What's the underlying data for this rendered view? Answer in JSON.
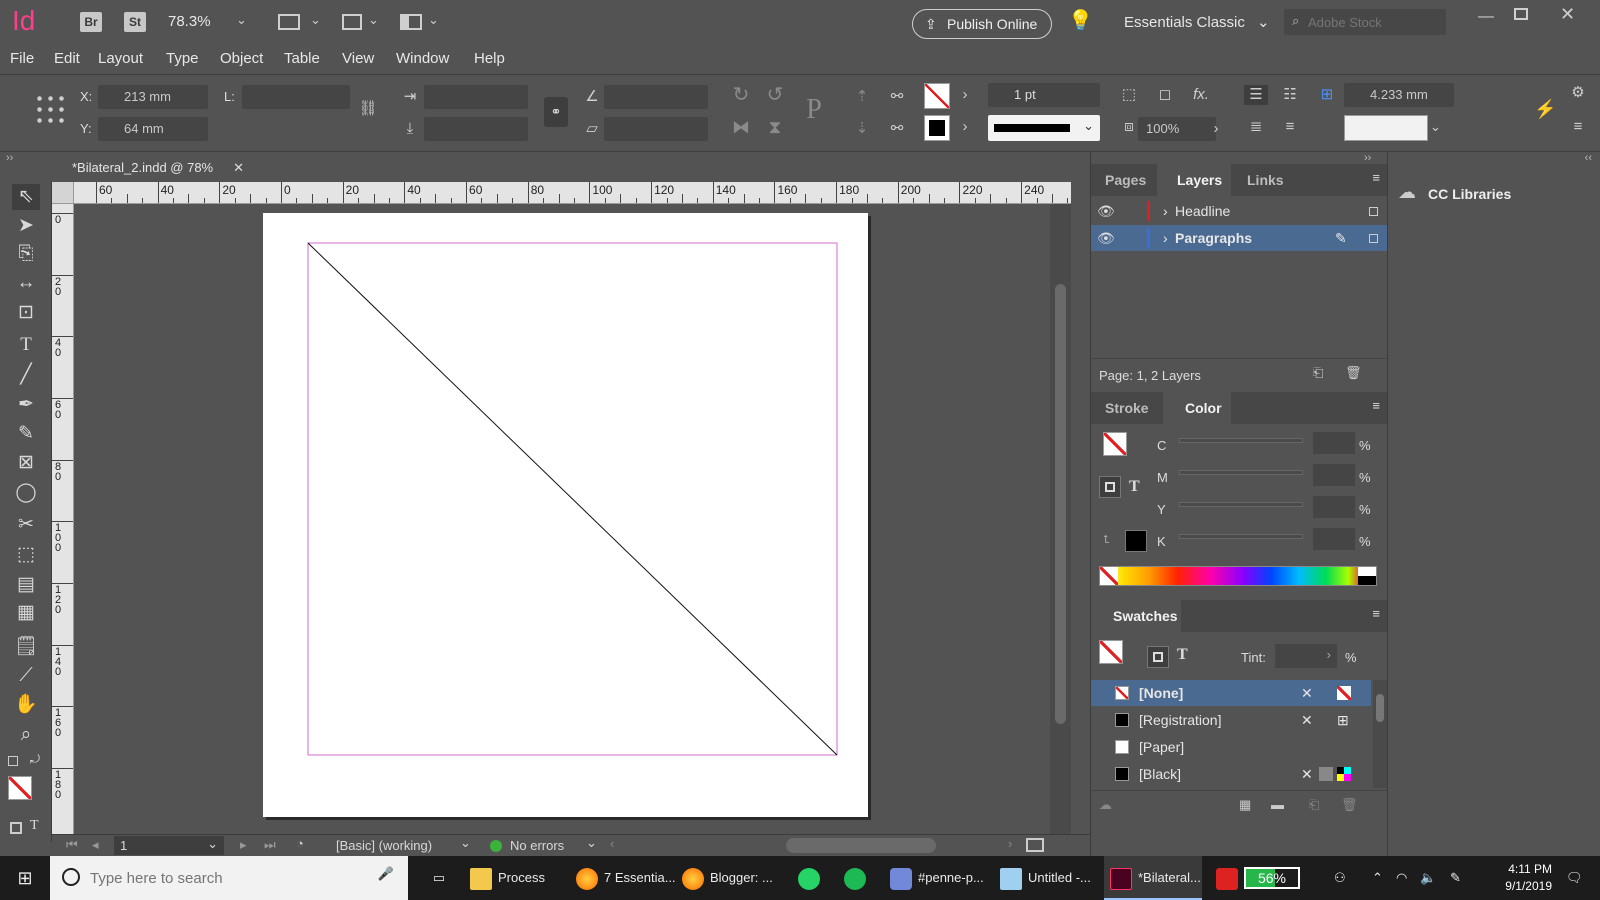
{
  "titlebar": {
    "app_logo": "Id",
    "bridge": "Br",
    "stock": "St",
    "zoom": "78.3%",
    "publish_online": "Publish Online",
    "workspace": "Essentials Classic",
    "search_placeholder": "Adobe Stock"
  },
  "menu": [
    "File",
    "Edit",
    "Layout",
    "Type",
    "Object",
    "Table",
    "View",
    "Window",
    "Help"
  ],
  "control": {
    "x_label": "X:",
    "x_value": "213 mm",
    "y_label": "Y:",
    "y_value": "64 mm",
    "l_label": "L:",
    "stroke_weight": "1 pt",
    "scale_percent": "100%",
    "spacing_value": "4.233 mm"
  },
  "document_tab": "*Bilateral_2.indd @ 78%",
  "hruler_labels": [
    "60",
    "40",
    "20",
    "0",
    "20",
    "40",
    "60",
    "80",
    "100",
    "120",
    "140",
    "160",
    "180",
    "200",
    "220",
    "240"
  ],
  "vruler_labels": [
    "0",
    "2\n0",
    "4\n0",
    "6\n0",
    "8\n0",
    "1\n0\n0",
    "1\n2\n0",
    "1\n4\n0",
    "1\n6\n0",
    "1\n8\n0"
  ],
  "status": {
    "page_number": "1",
    "preflight_profile": "[Basic] (working)",
    "errors": "No errors"
  },
  "layers_panel": {
    "tabs": [
      "Pages",
      "Layers",
      "Links"
    ],
    "layers": [
      {
        "name": "Headline",
        "color": "#e02020",
        "selected": false
      },
      {
        "name": "Paragraphs",
        "color": "#3a6ed8",
        "selected": true
      }
    ],
    "footer": "Page: 1, 2 Layers"
  },
  "color_panel": {
    "tabs": [
      "Stroke",
      "Color"
    ],
    "channels": [
      "C",
      "M",
      "Y",
      "K"
    ],
    "percent_sign": "%"
  },
  "swatches_panel": {
    "title": "Swatches",
    "tint_label": "Tint:",
    "tint_unit": "%",
    "swatches": [
      {
        "name": "[None]",
        "selected": true
      },
      {
        "name": "[Registration]",
        "selected": false
      },
      {
        "name": "[Paper]",
        "selected": false
      },
      {
        "name": "[Black]",
        "selected": false
      }
    ]
  },
  "cc_libraries": "CC Libraries",
  "taskbar": {
    "search_placeholder": "Type here to search",
    "apps": [
      "Process",
      "7 Essentia...",
      "Blogger: ...",
      "#penne-p...",
      "Untitled -...",
      "*Bilateral..."
    ],
    "battery": "56%",
    "time": "4:11 PM",
    "date": "9/1/2019"
  },
  "colors": {
    "accent": "#4b6a92",
    "indesign_brand": "#ff3366",
    "margin_guide": "#d26bd2"
  }
}
